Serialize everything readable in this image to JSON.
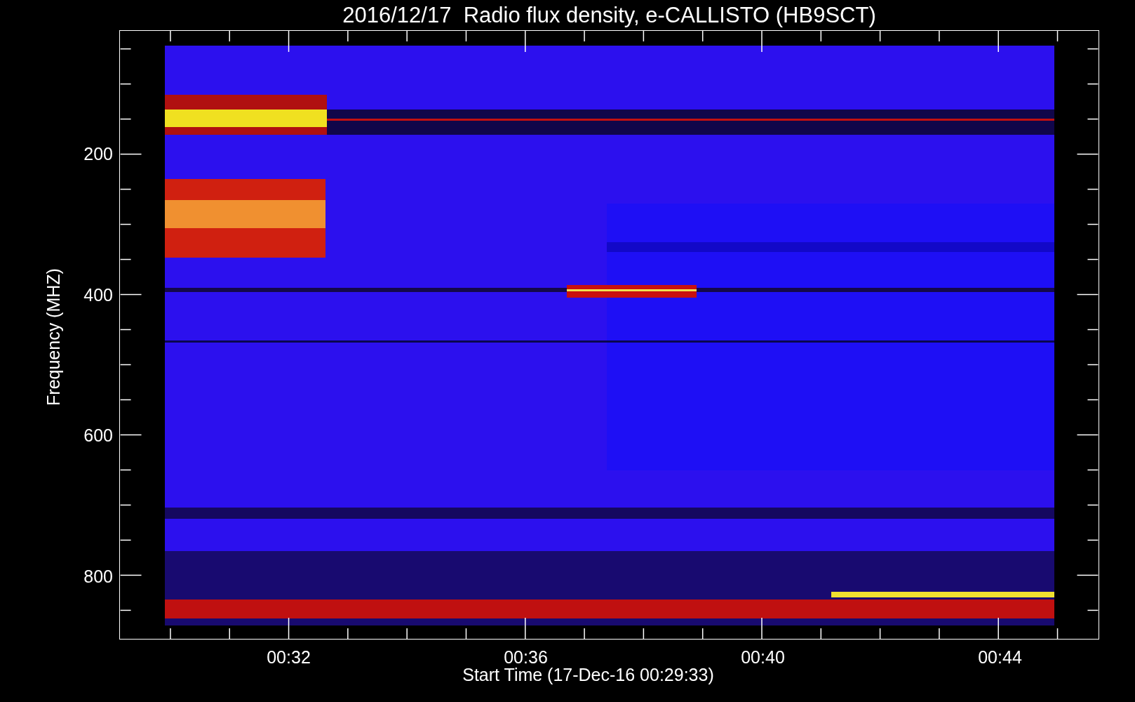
{
  "title": "2016/12/17  Radio flux density, e-CALLISTO (HB9SCT)",
  "y_axis": {
    "label": "Frequency (MHZ)",
    "ticks": [
      "200",
      "400",
      "600",
      "800"
    ]
  },
  "x_axis": {
    "label": "Start Time (17-Dec-16 00:29:33)",
    "ticks": [
      "00:32",
      "00:36",
      "00:40",
      "00:44"
    ]
  }
}
